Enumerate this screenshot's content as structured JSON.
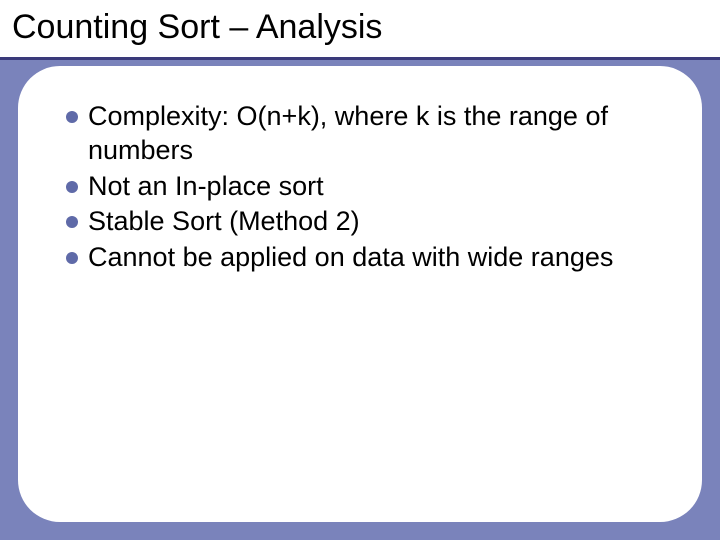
{
  "slide": {
    "title": "Counting Sort – Analysis",
    "bullets": [
      "Complexity: O(n+k), where k is the range of numbers",
      "Not an In-place sort",
      "Stable Sort (Method 2)",
      "Cannot be applied on data with wide ranges"
    ]
  }
}
